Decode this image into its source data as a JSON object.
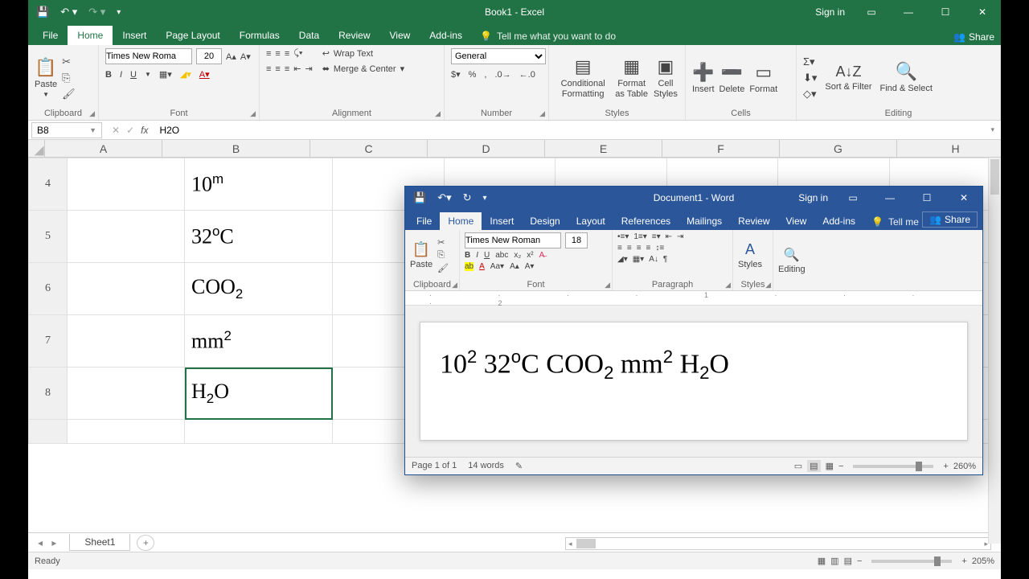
{
  "excel": {
    "title": "Book1 - Excel",
    "signin": "Sign in",
    "tabs": [
      "File",
      "Home",
      "Insert",
      "Page Layout",
      "Formulas",
      "Data",
      "Review",
      "View",
      "Add-ins"
    ],
    "active_tab": "Home",
    "tellme": "Tell me what you want to do",
    "share": "Share",
    "ribbon": {
      "clipboard": {
        "label": "Clipboard",
        "paste": "Paste"
      },
      "font": {
        "label": "Font",
        "name": "Times New Roma",
        "size": "20"
      },
      "alignment": {
        "label": "Alignment",
        "wrap": "Wrap Text",
        "merge": "Merge & Center"
      },
      "number": {
        "label": "Number",
        "format": "General"
      },
      "styles": {
        "label": "Styles",
        "cond": "Conditional Formatting",
        "fmt": "Format as Table",
        "cell": "Cell Styles"
      },
      "cells": {
        "label": "Cells",
        "insert": "Insert",
        "delete": "Delete",
        "format": "Format"
      },
      "editing": {
        "label": "Editing",
        "sort": "Sort & Filter",
        "find": "Find & Select"
      }
    },
    "namebox": "B8",
    "formula": "H2O",
    "columns": [
      "A",
      "B",
      "C",
      "D",
      "E",
      "F",
      "G",
      "H"
    ],
    "rows": [
      {
        "n": "4",
        "b_base": "10",
        "b_sup": "m"
      },
      {
        "n": "5",
        "b_pre": "32",
        "b_sup": "o",
        "b_post": "C"
      },
      {
        "n": "6",
        "b_pre": "COO",
        "b_sub": "2"
      },
      {
        "n": "7",
        "b_pre": "mm",
        "b_sup": "2"
      },
      {
        "n": "8",
        "b_pre": "H",
        "b_sub": "2",
        "b_post": "O",
        "selected": true
      }
    ],
    "sheet_tab": "Sheet1",
    "status": "Ready",
    "zoom": "205%"
  },
  "word": {
    "title": "Document1 - Word",
    "signin": "Sign in",
    "tabs": [
      "File",
      "Home",
      "Insert",
      "Design",
      "Layout",
      "References",
      "Mailings",
      "Review",
      "View",
      "Add-ins"
    ],
    "active_tab": "Home",
    "tellme": "Tell me",
    "share": "Share",
    "ribbon": {
      "clipboard": {
        "label": "Clipboard",
        "paste": "Paste"
      },
      "font": {
        "label": "Font",
        "name": "Times New Roman",
        "size": "18"
      },
      "para": {
        "label": "Paragraph"
      },
      "styles": {
        "label": "Styles",
        "btn": "Styles"
      },
      "editing": {
        "label": "",
        "btn": "Editing"
      }
    },
    "content_parts": [
      {
        "t": "10",
        "sup": "2"
      },
      {
        "t": " 32",
        "sup": "o",
        "post": "C"
      },
      {
        "t": " COO",
        "sub": "2"
      },
      {
        "t": " mm",
        "sup": "2"
      },
      {
        "t": " H",
        "sub": "2",
        "post": "O"
      }
    ],
    "status_page": "Page 1 of 1",
    "status_words": "14 words",
    "zoom": "260%"
  }
}
